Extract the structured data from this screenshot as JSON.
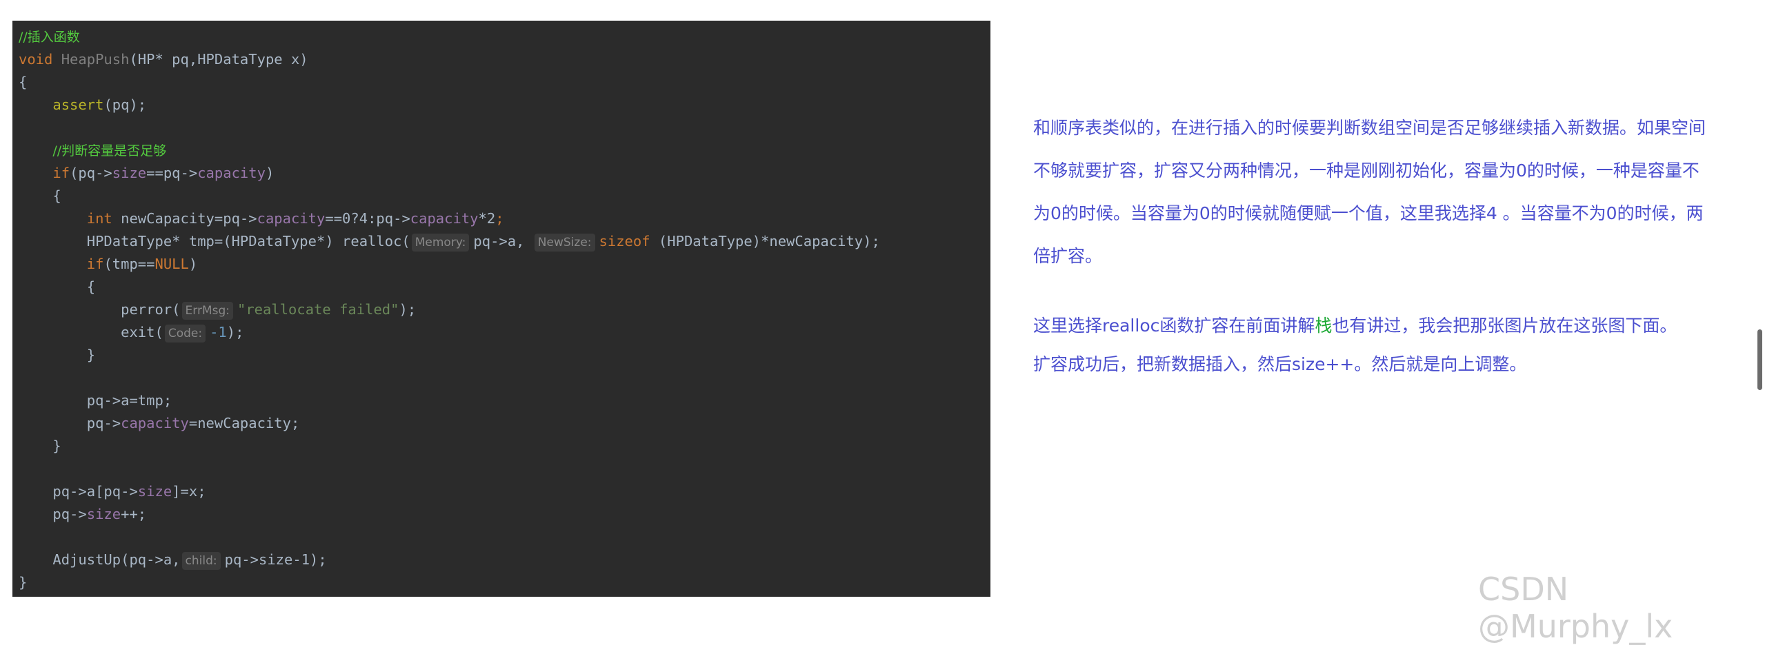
{
  "code": {
    "comment_insert": "//插入函数",
    "func_keyword": "void",
    "func_name": "HeapPush",
    "params": "(HP* pq,HPDataType x)",
    "open_brace": "{",
    "assert_call": "assert",
    "assert_args": "(pq);",
    "comment_capacity": "//判断容量是否足够",
    "if1_kw": "if",
    "if1_open": "(pq->",
    "field_size": "size",
    "eqeq_pq": "==pq->",
    "field_capacity": "capacity",
    "close_paren": ")",
    "int_kw": "int",
    "newcap_decl": " newCapacity=pq->",
    "ternary_a": "==0?4:pq->",
    "times_two": "*2",
    "semicolon": ";",
    "tmp_decl": "HPDataType* tmp=(HPDataType*) realloc(",
    "hint_memory": "Memory:",
    "arg_pq_a": "pq->a,",
    "hint_newsize": "NewSize:",
    "sizeof_kw": "sizeof",
    "sizeof_rest": " (HPDataType)*newCapacity);",
    "if2_kw": "if",
    "if2_open": "(tmp==",
    "null_kw": "NULL",
    "perror_call": "perror(",
    "hint_errmsg": "ErrMsg:",
    "errmsg_str": "\"reallocate failed\"",
    "perror_close": ");",
    "exit_call": "exit(",
    "hint_code": "Code:",
    "exit_val": "-1",
    "exit_close": ");",
    "close_brace": "}",
    "assign_a": "pq->a=tmp;",
    "assign_cap_a": "pq->",
    "assign_cap_b": "=newCapacity;",
    "insert_a": "pq->a[pq->",
    "insert_b": "]=x;",
    "size_inc_a": "pq->",
    "size_inc_b": "++;",
    "adjust_call": "AdjustUp(pq->a,",
    "hint_child": "child:",
    "adjust_arg": "pq->size-1);"
  },
  "explanation": {
    "para1": "和顺序表类似的，在进行插入的时候要判断数组空间是否足够继续插入新数据。如果空间不够就要扩容，扩容又分两种情况，一种是刚刚初始化，容量为0的时候，一种是容量不为0的时候。当容量为0的时候就随便赋一个值，这里我选择4 。当容量不为0的时候，两倍扩容。",
    "para2_before": "这里选择realloc函数扩容在前面讲解",
    "para2_link": "栈",
    "para2_after": "也有讲过，我会把那张图片放在这张图下面。",
    "para3": "扩容成功后，把新数据插入，然后size++。然后就是向上调整。"
  },
  "watermark": "CSDN @Murphy_lx",
  "colors": {
    "code_bg": "#2b2b2b",
    "comment": "#53c93f",
    "keyword": "#cc7832",
    "field": "#9876aa",
    "number": "#6897bb",
    "string": "#6a8759",
    "text": "#4b4fcf",
    "link": "#19a832"
  }
}
